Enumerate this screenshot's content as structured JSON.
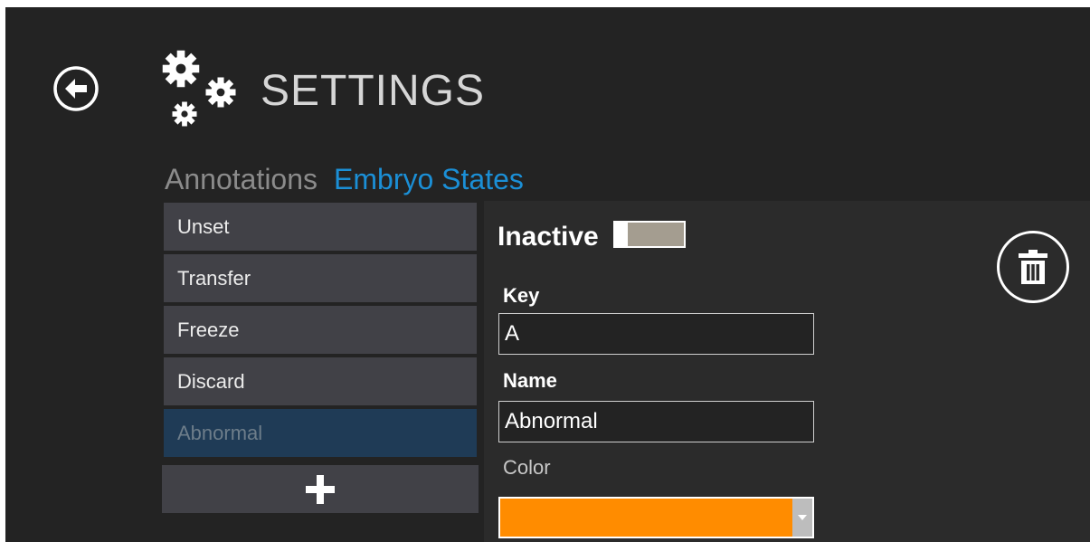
{
  "header": {
    "title": "SETTINGS",
    "back_icon": "back-arrow-circle-icon",
    "title_icon": "gears-icon"
  },
  "tabs": [
    {
      "label": "Annotations",
      "active": false
    },
    {
      "label": "Embryo States",
      "active": true
    }
  ],
  "states": [
    {
      "label": "Unset",
      "selected": false
    },
    {
      "label": "Transfer",
      "selected": false
    },
    {
      "label": "Freeze",
      "selected": false
    },
    {
      "label": "Discard",
      "selected": false
    },
    {
      "label": "Abnormal",
      "selected": true
    }
  ],
  "add_button_icon": "plus-icon",
  "editor": {
    "active_label": "Inactive",
    "active_toggle_on": false,
    "delete_icon": "trash-icon",
    "key_label": "Key",
    "key_value": "A",
    "name_label": "Name",
    "name_value": "Abnormal",
    "color_label": "Color",
    "color_value": "#ff8c00"
  },
  "colors": {
    "accent": "#1b8fd6",
    "background": "#232323",
    "list_item": "#414147",
    "selected_item": "#1f3b56"
  }
}
